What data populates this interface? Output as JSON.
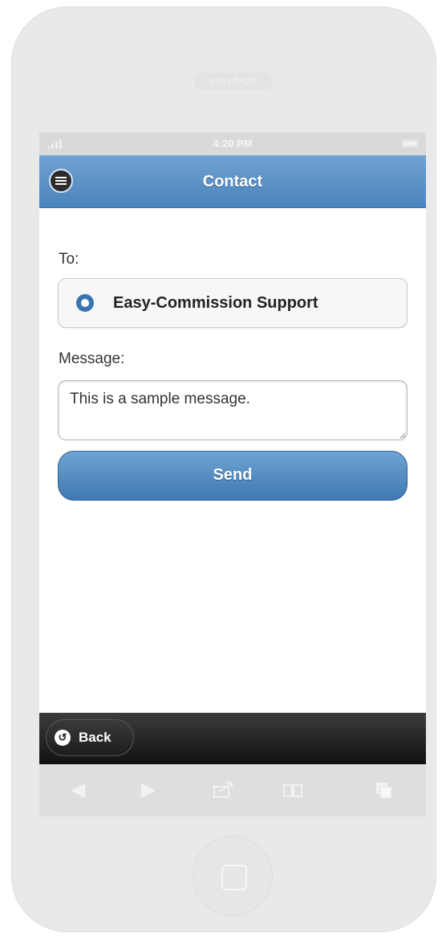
{
  "device": {
    "speaker_text": "easyfin26",
    "status_time": "4:20 PM"
  },
  "header": {
    "title": "Contact",
    "menu_icon": "menu-lines-icon"
  },
  "form": {
    "to_label": "To:",
    "recipient_option": "Easy-Commission Support",
    "recipient_selected": true,
    "message_label": "Message:",
    "message_value": "This is a sample message.",
    "send_label": "Send"
  },
  "footer": {
    "back_label": "Back",
    "back_icon": "undo-arrow-icon"
  },
  "browser_toolbar": {
    "icons": [
      "back-arrow-icon",
      "forward-arrow-icon",
      "share-icon",
      "bookmarks-icon",
      "tabs-icon"
    ]
  },
  "colors": {
    "header_blue": "#4b84bd",
    "button_blue": "#3f78b1",
    "footer_black": "#1d1d1d",
    "phone_body": "#e9e9e9"
  }
}
